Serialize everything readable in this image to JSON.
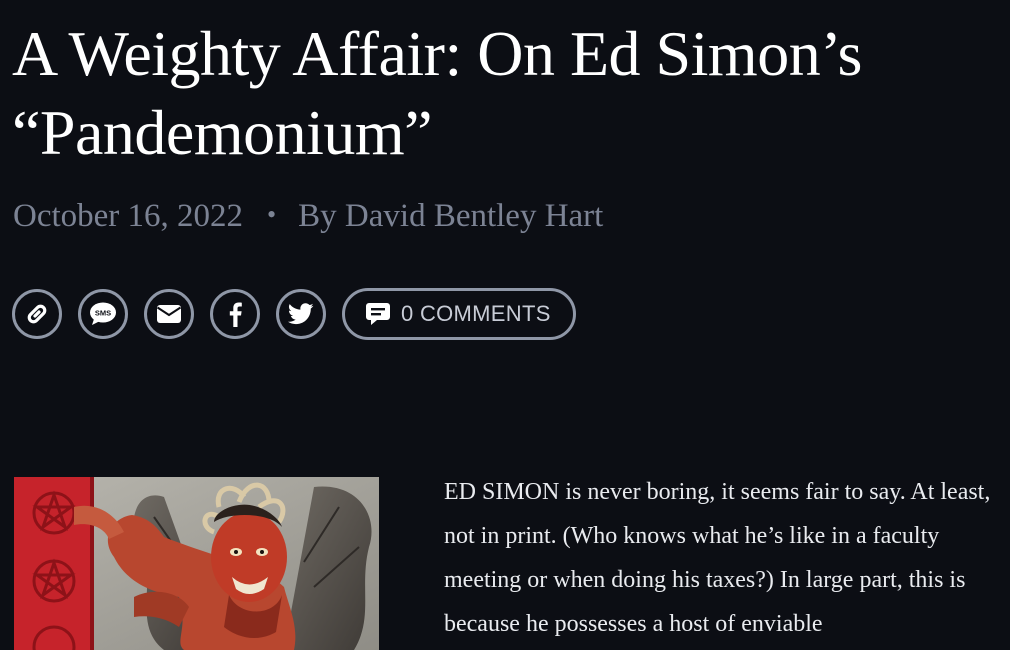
{
  "article": {
    "title": "A Weighty Affair: On Ed Simon’s “Pandemonium”",
    "date": "October 16, 2022",
    "separator": "•",
    "byline": "By David Bentley Hart",
    "body_first_paragraph": "ED SIMON is never boring, it seems fair to say. At least, not in print. (Who knows what he’s like in a faculty meeting or when doing his taxes?) In large part, this is because he possesses a host of enviable"
  },
  "share": {
    "buttons": [
      {
        "icon": "link-icon"
      },
      {
        "icon": "sms-icon",
        "text": "SMS"
      },
      {
        "icon": "email-icon"
      },
      {
        "icon": "facebook-icon"
      },
      {
        "icon": "twitter-icon"
      }
    ],
    "comments_label": "0 COMMENTS",
    "comments_icon": "comment-icon"
  },
  "colors": {
    "background": "#0c0e14",
    "meta_text": "#7c8394",
    "button_border": "#8f97a7",
    "cover_red": "#c6232b"
  }
}
